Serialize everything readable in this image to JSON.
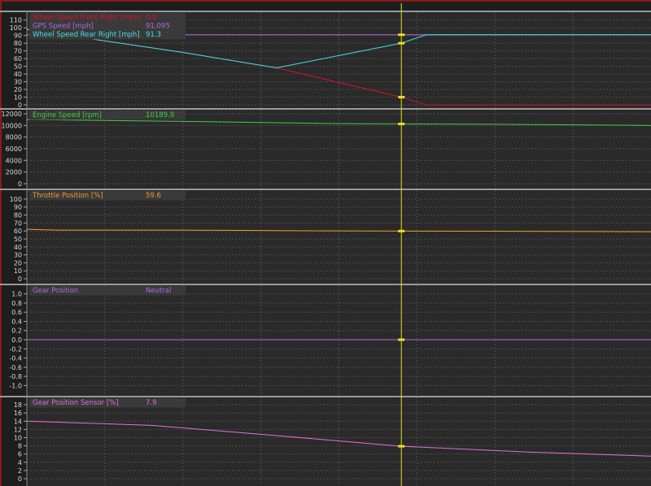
{
  "colors": {
    "wheel_front_right": "#d0142a",
    "gps_speed": "#b266e0",
    "wheel_rear_right": "#44e0e8",
    "engine_speed": "#3fcf3f",
    "throttle": "#f09a2a",
    "gear_position": "#b266e0",
    "gear_sensor": "#e070d8",
    "cursor": "#e8e020",
    "grid": "#4a4a4a",
    "background": "#2a2a2a"
  },
  "chart_data": [
    {
      "type": "line",
      "x": [
        0,
        0.25,
        0.4,
        0.6,
        0.64,
        0.8,
        1.0
      ],
      "series": [
        {
          "name": "Wheel Speed Front Right [mph]",
          "value_label": "0.0",
          "values": [
            98,
            68,
            48,
            10,
            0,
            0,
            0
          ]
        },
        {
          "name": "GPS Speed [mph]",
          "value_label": "91.095",
          "values": [
            91,
            91,
            91,
            91,
            91,
            91,
            91
          ]
        },
        {
          "name": "Wheel Speed Rear Right [mph]",
          "value_label": "91.3",
          "values": [
            98,
            68,
            48,
            80,
            91,
            91,
            91
          ]
        }
      ],
      "ylim": [
        0,
        115
      ],
      "yticks": [
        "110",
        "100",
        "90",
        "80",
        "70",
        "60",
        "50",
        "40",
        "30",
        "20",
        "10",
        "0"
      ],
      "cursor_x": 0.6
    },
    {
      "type": "line",
      "x": [
        0,
        0.25,
        0.5,
        0.75,
        1.0
      ],
      "series": [
        {
          "name": "Engine Speed [rpm]",
          "value_label": "10189.9",
          "values": [
            11000,
            10700,
            10300,
            10200,
            10000
          ]
        }
      ],
      "ylim": [
        0,
        12000
      ],
      "yticks": [
        "12000",
        "10000",
        "8000",
        "6000",
        "4000",
        "2000",
        "0"
      ],
      "cursor_x": 0.6
    },
    {
      "type": "line",
      "x": [
        0,
        0.05,
        0.25,
        0.5,
        0.75,
        1.0
      ],
      "series": [
        {
          "name": "Throttle Position [%]",
          "value_label": "59.6",
          "values": [
            62,
            61,
            61,
            60,
            59.6,
            59
          ]
        }
      ],
      "ylim": [
        0,
        105
      ],
      "yticks": [
        "100",
        "90",
        "80",
        "70",
        "60",
        "50",
        "40",
        "30",
        "20",
        "10",
        "0"
      ],
      "cursor_x": 0.6
    },
    {
      "type": "line",
      "x": [
        0,
        1.0
      ],
      "series": [
        {
          "name": "Gear Position",
          "value_label": "Neutral",
          "values": [
            0,
            0
          ]
        }
      ],
      "ylim": [
        -1.1,
        1.1
      ],
      "yticks": [
        "1.0",
        "0.8",
        "0.6",
        "0.4",
        "0.2",
        "0.0",
        "-0.2",
        "-0.4",
        "-0.6",
        "-0.8",
        "-1.0"
      ],
      "cursor_x": 0.6
    },
    {
      "type": "line",
      "x": [
        0,
        0.2,
        0.4,
        0.6,
        0.8,
        1.0
      ],
      "series": [
        {
          "name": "Gear Position Sensor [%]",
          "value_label": "7.9",
          "values": [
            14,
            13,
            10.5,
            7.9,
            6.5,
            5.5
          ]
        }
      ],
      "ylim": [
        0,
        19
      ],
      "yticks": [
        "18",
        "16",
        "14",
        "12",
        "10",
        "8",
        "6",
        "4",
        "2",
        "0"
      ],
      "cursor_x": 0.6
    }
  ]
}
